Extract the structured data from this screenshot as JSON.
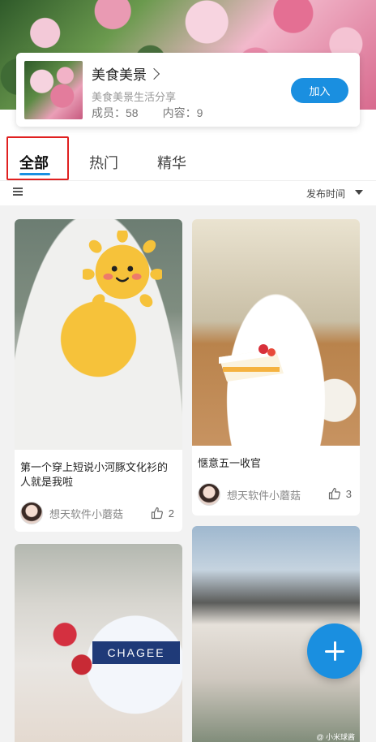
{
  "group": {
    "title": "美食美景",
    "description": "美食美景生活分享",
    "members_label": "成员：58",
    "content_label": "内容：9",
    "join_label": "加入"
  },
  "tabs": [
    {
      "label": "全部",
      "active": true
    },
    {
      "label": "热门",
      "active": false
    },
    {
      "label": "精华",
      "active": false
    }
  ],
  "sort": {
    "label": "发布时间"
  },
  "posts": [
    {
      "text": "第一个穿上短说小河豚文化衫的人就是我啦",
      "author": "想天软件小蘑菇",
      "likes": "2"
    },
    {
      "text": "惬意五一收官",
      "author": "想天软件小蘑菇",
      "likes": "3"
    },
    {
      "text": "",
      "author": "",
      "likes": "",
      "cup_text": "CHAGEE"
    },
    {
      "text": "",
      "author": "",
      "likes": "",
      "watermark": "@ 小米球酱"
    }
  ],
  "colors": {
    "accent": "#1a8fe0",
    "highlight": "#e02020",
    "feed_bg": "#f2f2f2"
  },
  "icons": {
    "list": "list-icon",
    "sort_caret": "caret-down-icon",
    "like": "thumbs-up-icon",
    "fab": "plus-icon",
    "chevron": "chevron-right-icon"
  }
}
